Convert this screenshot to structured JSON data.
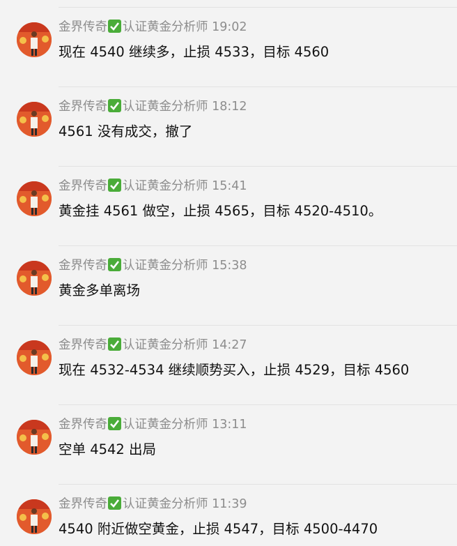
{
  "colors": {
    "background": "#f3f3f3",
    "meta_text": "#8d8d8d",
    "message_text": "#111111",
    "verified_badge": "#4aac39",
    "avatar_bg": "#e25a2c"
  },
  "messages": [
    {
      "author": "金界传奇",
      "verified_icon": "check-icon",
      "title": "认证黄金分析师",
      "time": "19:02",
      "text": "现在 4540 继续多，止损 4533，目标 4560"
    },
    {
      "author": "金界传奇",
      "verified_icon": "check-icon",
      "title": "认证黄金分析师",
      "time": "18:12",
      "text": "4561 没有成交，撤了"
    },
    {
      "author": "金界传奇",
      "verified_icon": "check-icon",
      "title": "认证黄金分析师",
      "time": "15:41",
      "text": "黄金挂 4561 做空，止损 4565，目标 4520-4510。"
    },
    {
      "author": "金界传奇",
      "verified_icon": "check-icon",
      "title": "认证黄金分析师",
      "time": "15:38",
      "text": "黄金多单离场"
    },
    {
      "author": "金界传奇",
      "verified_icon": "check-icon",
      "title": "认证黄金分析师",
      "time": "14:27",
      "text": "现在 4532-4534 继续顺势买入，止损 4529，目标 4560"
    },
    {
      "author": "金界传奇",
      "verified_icon": "check-icon",
      "title": "认证黄金分析师",
      "time": "13:11",
      "text": "空单 4542 出局"
    },
    {
      "author": "金界传奇",
      "verified_icon": "check-icon",
      "title": "认证黄金分析师",
      "time": "11:39",
      "text": "4540 附近做空黄金，止损 4547，目标 4500-4470"
    }
  ]
}
